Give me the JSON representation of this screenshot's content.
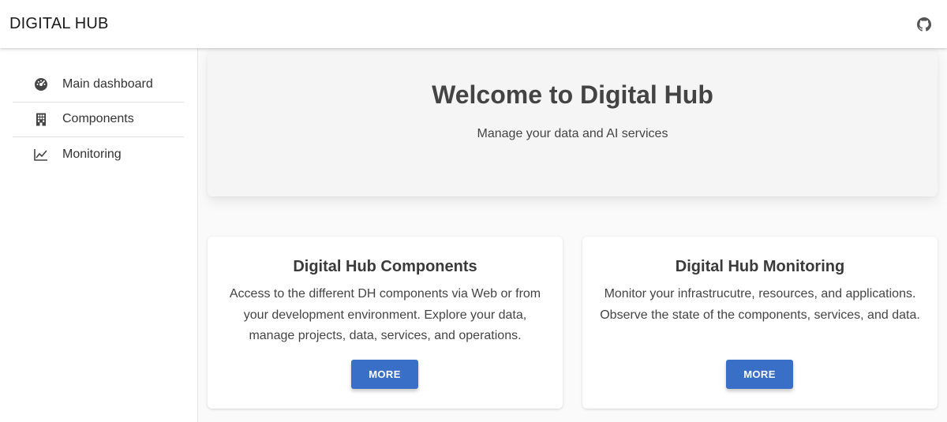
{
  "app": {
    "title": "DIGITAL HUB",
    "github_icon": "github-icon"
  },
  "sidebar": {
    "items": [
      {
        "label": "Main dashboard",
        "icon": "dashboard-gauge-icon"
      },
      {
        "label": "Components",
        "icon": "building-icon"
      },
      {
        "label": "Monitoring",
        "icon": "line-chart-icon"
      }
    ]
  },
  "hero": {
    "title": "Welcome to Digital Hub",
    "subtitle": "Manage your data and AI services"
  },
  "cards": [
    {
      "title": "Digital Hub Components",
      "text": "Access to the different DH components via Web or from your development environment. Explore your data, manage projects, data, services, and operations.",
      "button": "MORE"
    },
    {
      "title": "Digital Hub Monitoring",
      "text": "Monitor your infrastrucutre, resources, and applications. Observe the state of the components, services, and data.",
      "button": "MORE"
    }
  ],
  "colors": {
    "accent": "#3a6fc7",
    "appbar_bg": "#ffffff",
    "page_bg": "#fafafa",
    "hero_bg": "#f5f5f5"
  }
}
